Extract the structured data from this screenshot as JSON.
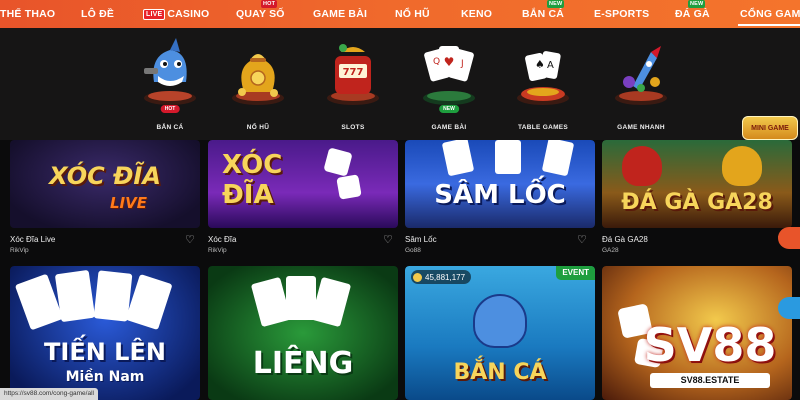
{
  "nav": {
    "items": [
      {
        "label": "THỂ THAO",
        "badge": ""
      },
      {
        "label": "LÔ ĐỀ",
        "badge": ""
      },
      {
        "label": "CASINO",
        "badge": "",
        "prefix": "LIVE"
      },
      {
        "label": "QUAY SỐ",
        "badge": "HOT"
      },
      {
        "label": "GAME BÀI",
        "badge": ""
      },
      {
        "label": "NỔ HŨ",
        "badge": ""
      },
      {
        "label": "KENO",
        "badge": ""
      },
      {
        "label": "BẮN CÁ",
        "badge": "NEW"
      },
      {
        "label": "E-SPORTS",
        "badge": ""
      },
      {
        "label": "ĐÁ GÀ",
        "badge": "NEW"
      },
      {
        "label": "CỔNG GAME",
        "badge": ""
      }
    ]
  },
  "categories": [
    {
      "label": "BẮN CÁ",
      "badge": "HOT",
      "icon": "shark-icon"
    },
    {
      "label": "NỔ HŨ",
      "badge": "",
      "icon": "money-bag-icon"
    },
    {
      "label": "SLOTS",
      "badge": "",
      "icon": "slot-machine-icon"
    },
    {
      "label": "GAME BÀI",
      "badge": "NEW",
      "icon": "playing-cards-icon"
    },
    {
      "label": "TABLE GAMES",
      "badge": "",
      "icon": "table-cards-icon"
    },
    {
      "label": "GAME NHANH",
      "badge": "",
      "icon": "rocket-icon"
    }
  ],
  "games": [
    {
      "name": "Xóc Đĩa Live",
      "provider": "RikVip",
      "art_title": "XÓC ĐĨA",
      "art_sub": "LIVE"
    },
    {
      "name": "Xóc Đĩa",
      "provider": "RikVip",
      "art_title": "XÓC ĐĨA",
      "art_sub": ""
    },
    {
      "name": "Sâm Lốc",
      "provider": "Go88",
      "art_title": "SÂM LỐC",
      "art_sub": ""
    },
    {
      "name": "Đá Gà GA28",
      "provider": "GA28",
      "art_title": "ĐÁ GÀ GA28",
      "art_sub": ""
    },
    {
      "name": "",
      "provider": "",
      "art_title": "TIẾN LÊN",
      "art_sub": "Miền Nam"
    },
    {
      "name": "",
      "provider": "",
      "art_title": "LIÊNG",
      "art_sub": ""
    },
    {
      "name": "",
      "provider": "",
      "art_title": "BẮN CÁ",
      "art_sub": "",
      "balance": "45,881,177",
      "tag": "EVENT"
    },
    {
      "name": "",
      "provider": "",
      "art_title": "",
      "art_sub": ""
    }
  ],
  "mini_game": "MINI GAME",
  "status_url": "https://sv88.com/cong-game/all",
  "watermark": {
    "brand": "SV88",
    "domain": "SV88.ESTATE"
  }
}
